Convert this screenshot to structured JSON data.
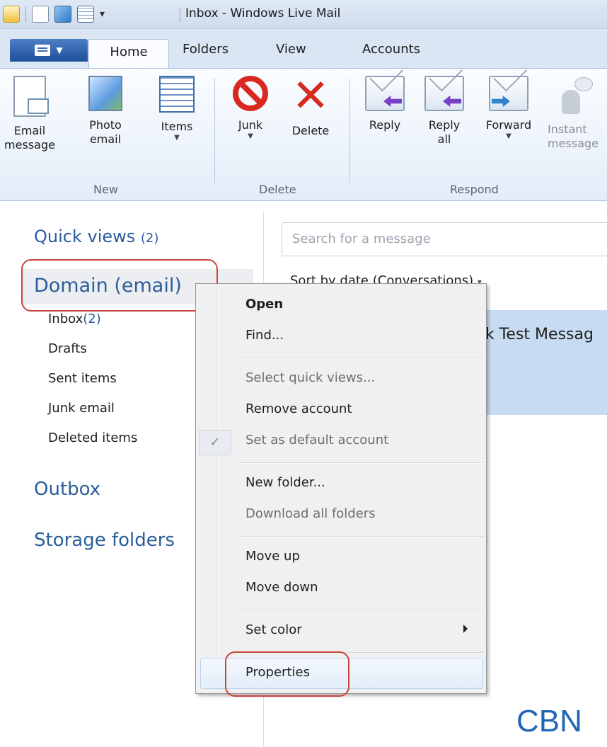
{
  "window": {
    "title": "Inbox - Windows Live Mail"
  },
  "tabs": [
    "Home",
    "Folders",
    "View",
    "Accounts"
  ],
  "ribbon": {
    "buttons": {
      "email_message": [
        "Email",
        "message"
      ],
      "photo_email": [
        "Photo",
        "email"
      ],
      "items": [
        "Items"
      ],
      "junk": [
        "Junk"
      ],
      "delete": [
        "Delete"
      ],
      "reply": [
        "Reply"
      ],
      "reply_all": [
        "Reply",
        "all"
      ],
      "forward": [
        "Forward"
      ],
      "instant_message": [
        "Instant",
        "message"
      ]
    },
    "groups": [
      "New",
      "Delete",
      "Respond"
    ]
  },
  "folder_pane": {
    "quick_views": {
      "label": "Quick views",
      "count": "(2)"
    },
    "account": "Domain (email)",
    "folders": [
      {
        "label": "Inbox",
        "count": "(2)"
      },
      {
        "label": "Drafts"
      },
      {
        "label": "Sent items"
      },
      {
        "label": "Junk email"
      },
      {
        "label": "Deleted items"
      }
    ],
    "outbox": "Outbox",
    "storage": "Storage folders"
  },
  "message_list": {
    "search_placeholder": "Search for a message",
    "sort": "Sort by date (Conversations)",
    "selected_subject": "k Test Messag"
  },
  "context_menu": {
    "items": [
      {
        "label": "Open",
        "bold": true
      },
      {
        "label": "Find..."
      },
      {
        "label": "Select quick views...",
        "disabled": true
      },
      {
        "label": "Remove account"
      },
      {
        "label": "Set as default account",
        "disabled": true,
        "checked": true
      },
      {
        "label": "New folder..."
      },
      {
        "label": "Download all folders",
        "disabled": true
      },
      {
        "label": "Move up"
      },
      {
        "label": "Move down"
      },
      {
        "label": "Set color",
        "submenu": true
      },
      {
        "label": "Properties",
        "highlighted": true
      }
    ]
  },
  "watermark": "CBN",
  "colors": {
    "accent": "#2b5d9a",
    "annotation": "#c9443f",
    "selection": "#c7dcf2",
    "brand": "#2166b6"
  }
}
